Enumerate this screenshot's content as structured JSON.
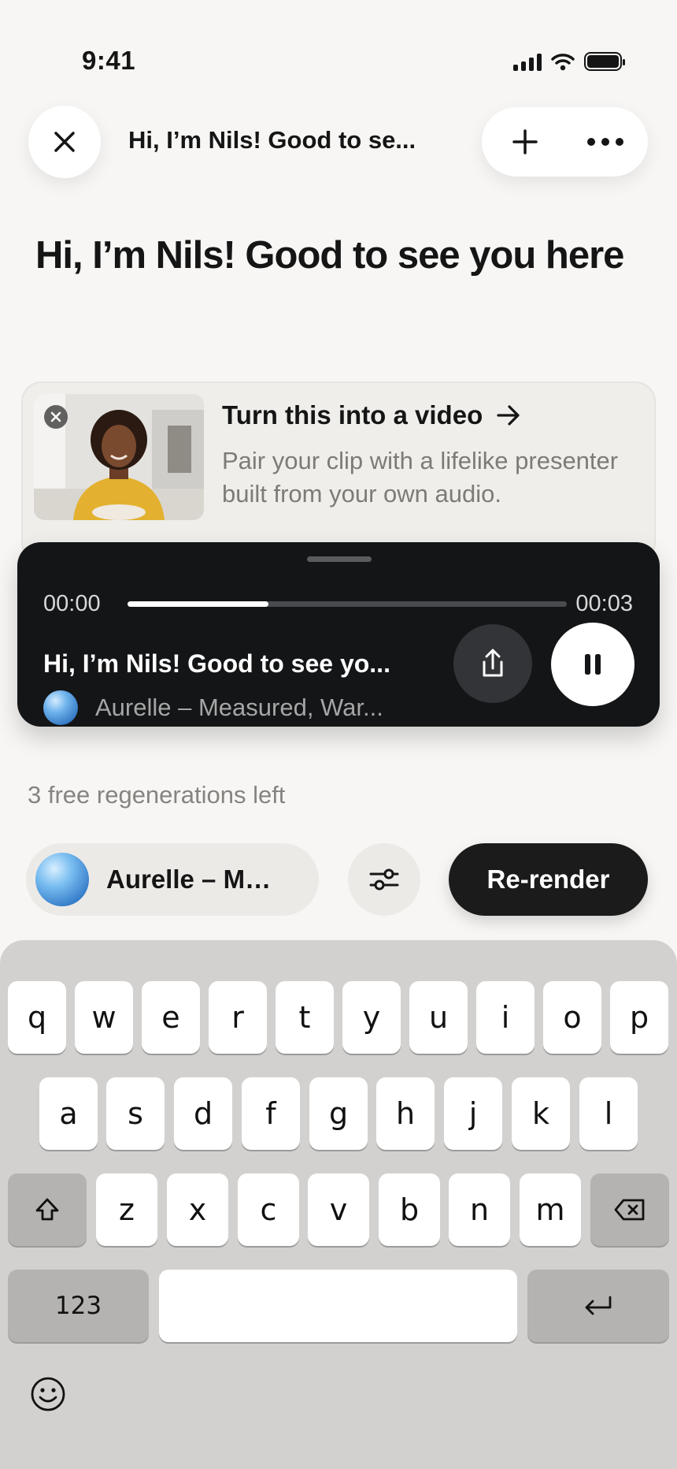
{
  "status_bar": {
    "time": "9:41"
  },
  "header": {
    "title": "Hi, I’m Nils! Good to se...",
    "close_icon": "close-icon",
    "add_icon": "plus-icon",
    "more_icon": "ellipsis-icon"
  },
  "page_title": "Hi, I’m Nils! Good to see you here",
  "promo": {
    "title": "Turn this into a video",
    "description": "Pair your clip with a lifelike presenter built from your own audio.",
    "arrow_icon": "arrow-right-icon"
  },
  "player": {
    "time_current": "00:00",
    "time_total": "00:03",
    "progress": 0.32,
    "title": "Hi, I’m Nils! Good to see yo...",
    "voice": "Aurelle – Measured, War...",
    "share_icon": "share-icon",
    "pause_icon": "pause-icon"
  },
  "regenerations_note": "3 free regenerations left",
  "controls": {
    "voice_label": "Aurelle – Me...",
    "settings_icon": "sliders-icon",
    "rerender_label": "Re-render"
  },
  "keyboard": {
    "row1": [
      "q",
      "w",
      "e",
      "r",
      "t",
      "y",
      "u",
      "i",
      "o",
      "p"
    ],
    "row2": [
      "a",
      "s",
      "d",
      "f",
      "g",
      "h",
      "j",
      "k",
      "l"
    ],
    "row3": [
      "z",
      "x",
      "c",
      "v",
      "b",
      "n",
      "m"
    ],
    "numbers_label": "123"
  },
  "colors": {
    "background": "#f7f6f4",
    "player_bg": "#141517",
    "keyboard_bg": "#d2d1cf",
    "accent_dark": "#1b1b1b"
  }
}
